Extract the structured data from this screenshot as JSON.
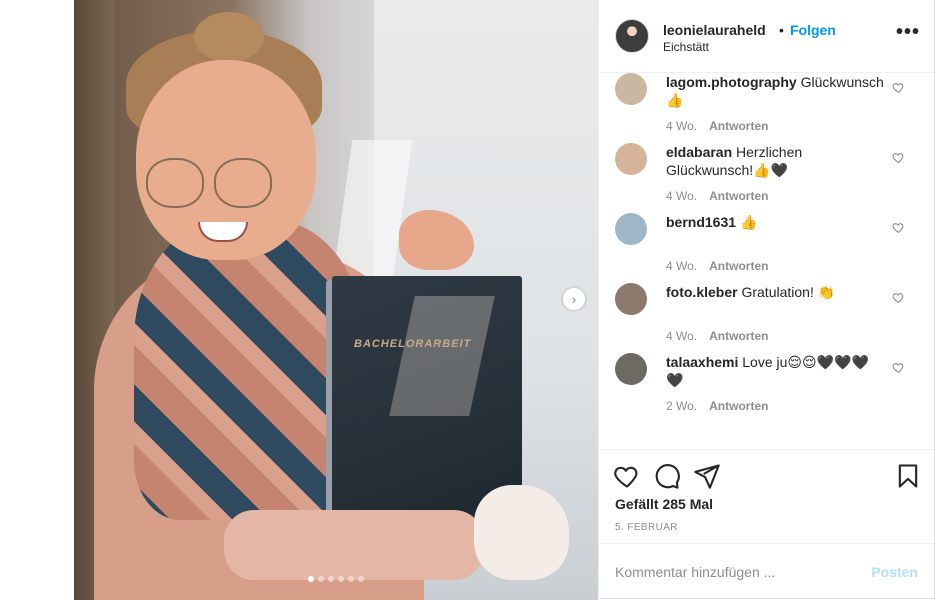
{
  "post": {
    "owner": {
      "username": "leonielauraheld",
      "location": "Eichstätt"
    },
    "follow_label": "Folgen",
    "separator": "•",
    "more_label": "•••",
    "image": {
      "book_text": "BACHELORARBEIT",
      "slide_count": 6,
      "active_slide": 0
    },
    "next_icon": "chevron-right-icon"
  },
  "comments": [
    {
      "username": "lagom.photography",
      "text": "Glückwunsch 👍",
      "age": "4 Wo.",
      "reply": "Antworten",
      "avatar_color": "#c9b7a2"
    },
    {
      "username": "eldabaran",
      "text": "Herzlichen Glückwunsch!👍🖤",
      "age": "4 Wo.",
      "reply": "Antworten",
      "avatar_color": "#d6b49a"
    },
    {
      "username": "bernd1631",
      "text": "👍",
      "age": "4 Wo.",
      "reply": "Antworten",
      "avatar_color": "#9fb6c9"
    },
    {
      "username": "foto.kleber",
      "text": "Gratulation! 👏",
      "age": "4 Wo.",
      "reply": "Antworten",
      "avatar_color": "#8b7a6c"
    },
    {
      "username": "talaaxhemi",
      "text": "Love ju😌😌🖤🖤🖤🖤",
      "age": "2 Wo.",
      "reply": "Antworten",
      "avatar_color": "#6c6a63"
    }
  ],
  "actions": {
    "likes_text": "Gefällt 285 Mal",
    "date": "5. FEBRUAR",
    "icons": [
      "heart-icon",
      "comment-icon",
      "share-icon",
      "bookmark-icon"
    ]
  },
  "add_comment": {
    "placeholder": "Kommentar hinzufügen ...",
    "post_label": "Posten"
  },
  "colors": {
    "link": "#0095f6",
    "muted": "#8e8e8e",
    "post_disabled": "#b2dffc"
  }
}
